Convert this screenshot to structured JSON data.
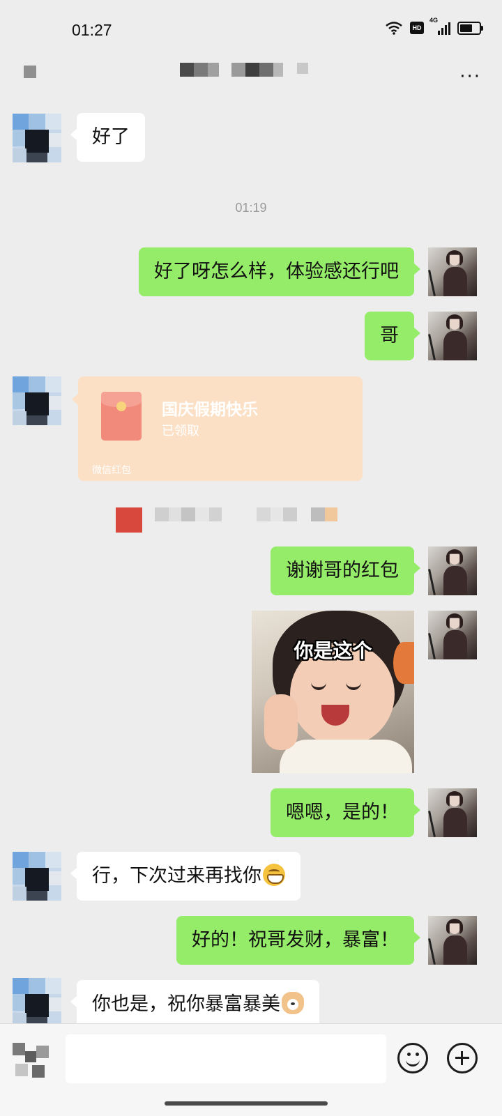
{
  "status_bar": {
    "time": "01:27",
    "hd": "HD",
    "network": "4G",
    "battery_level": 0.8
  },
  "chat_header": {
    "title": "",
    "more_label": "···"
  },
  "messages": [
    {
      "sender": "other",
      "text": "好了"
    },
    {
      "timestamp": "01:19"
    },
    {
      "sender": "me",
      "text": "好了呀怎么样，体验感还行吧"
    },
    {
      "sender": "me",
      "text": "哥"
    },
    {
      "sender": "other",
      "type": "red_packet",
      "title": "国庆假期快乐",
      "status": "已领取",
      "footer": "微信红包"
    },
    {
      "sender": "me",
      "text": "谢谢哥的红包"
    },
    {
      "sender": "me",
      "type": "sticker",
      "caption": "你是这个"
    },
    {
      "sender": "me",
      "text": "嗯嗯，是的！"
    },
    {
      "sender": "other",
      "text": "行，下次过来再找你",
      "emoji": "grinning-face"
    },
    {
      "sender": "me",
      "text": "好的！祝哥发财，暴富！"
    },
    {
      "sender": "other",
      "text": "你也是，祝你暴富暴美",
      "emoji": "doge-face"
    }
  ],
  "input_bar": {
    "placeholder": ""
  },
  "colors": {
    "background": "#ededed",
    "my_bubble": "#95ec69",
    "their_bubble": "#ffffff",
    "red_packet": "#fbe0c6"
  }
}
